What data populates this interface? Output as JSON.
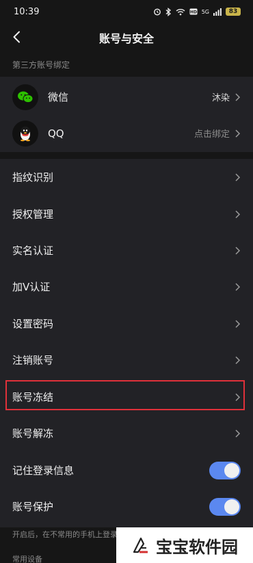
{
  "status_bar": {
    "time": "10:39",
    "network": "5G",
    "battery": "83"
  },
  "nav": {
    "title": "账号与安全"
  },
  "third_party": {
    "section_label": "第三方账号绑定",
    "items": [
      {
        "label": "微信",
        "value": "沐染",
        "icon": "wechat-icon"
      },
      {
        "label": "QQ",
        "value": "点击绑定",
        "icon": "qq-icon"
      }
    ]
  },
  "settings": {
    "items": [
      {
        "label": "指纹识别"
      },
      {
        "label": "授权管理"
      },
      {
        "label": "实名认证"
      },
      {
        "label": "加V认证"
      },
      {
        "label": "设置密码"
      },
      {
        "label": "注销账号"
      },
      {
        "label": "账号冻结"
      },
      {
        "label": "账号解冻"
      }
    ],
    "toggles": [
      {
        "label": "记住登录信息",
        "on": true
      },
      {
        "label": "账号保护",
        "on": true
      }
    ]
  },
  "hint": "开启后，在不常用的手机上登录",
  "hint2": "常用设备",
  "watermark": {
    "text": "宝宝软件园"
  },
  "colors": {
    "background": "#161616",
    "card": "#222226",
    "toggle_on": "#5b88f0",
    "highlight": "#e0313a"
  }
}
